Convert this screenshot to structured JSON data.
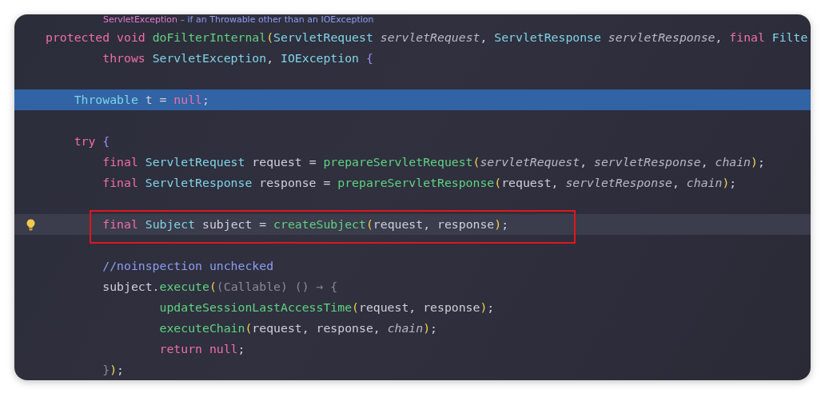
{
  "editor": {
    "doc_line": {
      "tokens": [
        {
          "kind": "doc_type",
          "text": "ServletException"
        },
        {
          "kind": "doc",
          "text": " – if an Throwable other than an IOException"
        }
      ]
    },
    "lines": [
      {
        "kind": "code",
        "selected": false,
        "current": false,
        "hint": false,
        "boxed": false,
        "tokens": [
          {
            "kind": "kw",
            "text": "protected void "
          },
          {
            "kind": "fn",
            "text": "doFilterInternal"
          },
          {
            "kind": "paren",
            "text": "("
          },
          {
            "kind": "type",
            "text": "ServletRequest "
          },
          {
            "kind": "param",
            "text": "servletRequest"
          },
          {
            "kind": "plain",
            "text": ", "
          },
          {
            "kind": "type",
            "text": "ServletResponse "
          },
          {
            "kind": "param",
            "text": "servletResponse"
          },
          {
            "kind": "plain",
            "text": ", "
          },
          {
            "kind": "kw",
            "text": "final "
          },
          {
            "kind": "type",
            "text": "Filte"
          }
        ],
        "children": [
          {
            "kind": "continuation",
            "selected": false,
            "current": false,
            "hint": false,
            "boxed": false,
            "tokens": [
              {
                "kind": "kw",
                "text": "throws "
              },
              {
                "kind": "type",
                "text": "ServletException"
              },
              {
                "kind": "plain",
                "text": ", "
              },
              {
                "kind": "type",
                "text": "IOException "
              },
              {
                "kind": "brace",
                "text": "{"
              }
            ]
          },
          {
            "kind": "blank"
          },
          {
            "kind": "code",
            "selected": true,
            "current": false,
            "hint": false,
            "boxed": false,
            "tokens": [
              {
                "kind": "type",
                "text": "Throwable "
              },
              {
                "kind": "plain",
                "text": "t = "
              },
              {
                "kind": "kw",
                "text": "null"
              },
              {
                "kind": "plain",
                "text": ";"
              }
            ]
          },
          {
            "kind": "blank"
          },
          {
            "kind": "code",
            "selected": false,
            "current": false,
            "hint": false,
            "boxed": false,
            "tokens": [
              {
                "kind": "kw",
                "text": "try "
              },
              {
                "kind": "brace",
                "text": "{"
              }
            ],
            "children": [
              {
                "kind": "code",
                "selected": false,
                "current": false,
                "hint": false,
                "boxed": false,
                "tokens": [
                  {
                    "kind": "kw",
                    "text": "final "
                  },
                  {
                    "kind": "type",
                    "text": "ServletRequest "
                  },
                  {
                    "kind": "plain",
                    "text": "request = "
                  },
                  {
                    "kind": "fn",
                    "text": "prepareServletRequest"
                  },
                  {
                    "kind": "paren",
                    "text": "("
                  },
                  {
                    "kind": "param",
                    "text": "servletRequest"
                  },
                  {
                    "kind": "plain",
                    "text": ", "
                  },
                  {
                    "kind": "param",
                    "text": "servletResponse"
                  },
                  {
                    "kind": "plain",
                    "text": ", "
                  },
                  {
                    "kind": "param",
                    "text": "chain"
                  },
                  {
                    "kind": "paren",
                    "text": ")"
                  },
                  {
                    "kind": "plain",
                    "text": ";"
                  }
                ]
              },
              {
                "kind": "code",
                "selected": false,
                "current": false,
                "hint": false,
                "boxed": false,
                "tokens": [
                  {
                    "kind": "kw",
                    "text": "final "
                  },
                  {
                    "kind": "type",
                    "text": "ServletResponse "
                  },
                  {
                    "kind": "plain",
                    "text": "response = "
                  },
                  {
                    "kind": "fn",
                    "text": "prepareServletResponse"
                  },
                  {
                    "kind": "paren",
                    "text": "("
                  },
                  {
                    "kind": "plain",
                    "text": "request, "
                  },
                  {
                    "kind": "param",
                    "text": "servletResponse"
                  },
                  {
                    "kind": "plain",
                    "text": ", "
                  },
                  {
                    "kind": "param",
                    "text": "chain"
                  },
                  {
                    "kind": "paren",
                    "text": ")"
                  },
                  {
                    "kind": "plain",
                    "text": ";"
                  }
                ]
              },
              {
                "kind": "blank"
              },
              {
                "kind": "code",
                "selected": false,
                "current": true,
                "hint": true,
                "boxed": true,
                "tokens": [
                  {
                    "kind": "kw",
                    "text": "final "
                  },
                  {
                    "kind": "type",
                    "text": "Subject "
                  },
                  {
                    "kind": "plain",
                    "text": "subject = "
                  },
                  {
                    "kind": "fn",
                    "text": "createSubject"
                  },
                  {
                    "kind": "paren",
                    "text": "("
                  },
                  {
                    "kind": "plain",
                    "text": "request, response"
                  },
                  {
                    "kind": "paren",
                    "text": ")"
                  },
                  {
                    "kind": "plain",
                    "text": ";"
                  }
                ]
              },
              {
                "kind": "blank"
              },
              {
                "kind": "code",
                "selected": false,
                "current": false,
                "hint": false,
                "boxed": false,
                "tokens": [
                  {
                    "kind": "comment",
                    "text": "//noinspection unchecked"
                  }
                ]
              },
              {
                "kind": "code",
                "selected": false,
                "current": false,
                "hint": false,
                "boxed": false,
                "tokens": [
                  {
                    "kind": "plain",
                    "text": "subject."
                  },
                  {
                    "kind": "fn",
                    "text": "execute"
                  },
                  {
                    "kind": "paren",
                    "text": "("
                  },
                  {
                    "kind": "hint",
                    "text": "(Callable) () → {"
                  }
                ],
                "children": [
                  {
                    "kind": "continuation",
                    "selected": false,
                    "current": false,
                    "hint": false,
                    "boxed": false,
                    "tokens": [
                      {
                        "kind": "fn",
                        "text": "updateSessionLastAccessTime"
                      },
                      {
                        "kind": "paren",
                        "text": "("
                      },
                      {
                        "kind": "plain",
                        "text": "request, response"
                      },
                      {
                        "kind": "paren",
                        "text": ")"
                      },
                      {
                        "kind": "plain",
                        "text": ";"
                      }
                    ]
                  },
                  {
                    "kind": "continuation",
                    "selected": false,
                    "current": false,
                    "hint": false,
                    "boxed": false,
                    "tokens": [
                      {
                        "kind": "fn",
                        "text": "executeChain"
                      },
                      {
                        "kind": "paren",
                        "text": "("
                      },
                      {
                        "kind": "plain",
                        "text": "request, response, "
                      },
                      {
                        "kind": "param",
                        "text": "chain"
                      },
                      {
                        "kind": "paren",
                        "text": ")"
                      },
                      {
                        "kind": "plain",
                        "text": ";"
                      }
                    ]
                  },
                  {
                    "kind": "continuation",
                    "selected": false,
                    "current": false,
                    "hint": false,
                    "boxed": false,
                    "tokens": [
                      {
                        "kind": "kw",
                        "text": "return null"
                      },
                      {
                        "kind": "plain",
                        "text": ";"
                      }
                    ]
                  }
                ]
              },
              {
                "kind": "code",
                "selected": false,
                "current": false,
                "hint": false,
                "boxed": false,
                "tokens": [
                  {
                    "kind": "hint",
                    "text": "}"
                  },
                  {
                    "kind": "paren",
                    "text": ")"
                  },
                  {
                    "kind": "plain",
                    "text": ";"
                  }
                ]
              }
            ]
          }
        ]
      }
    ]
  }
}
